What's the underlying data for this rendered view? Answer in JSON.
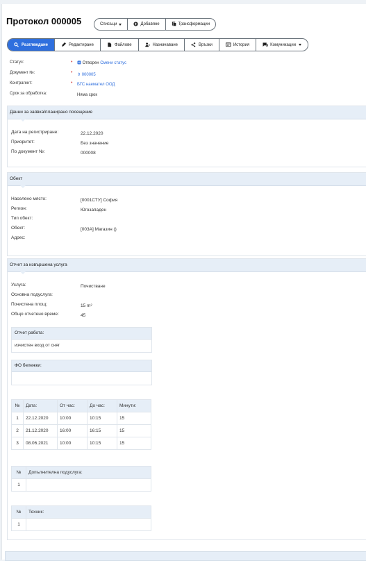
{
  "header": {
    "title": "Протокол 000005"
  },
  "toolbar": {
    "lists_label": "Списъци",
    "add_label": "Добавяне",
    "transform_label": "Трансформации"
  },
  "tabs": [
    "Разглеждане",
    "Редактиране",
    "Файлове",
    "Назначаване",
    "Връзки",
    "История",
    "Комуникации"
  ],
  "summary": {
    "status_label": "Статус:",
    "status_value": "Отворен",
    "status_action": "Смени статус",
    "document_label": "Документ №:",
    "document_value": "000005",
    "contractor_label": "Контрагент:",
    "contractor_value": "БГС наемател ООД",
    "deadline_label": "Срок за обработка:",
    "deadline_value": "Няма срок"
  },
  "request": {
    "title": "Данни за заявка/планирано посещение",
    "reg_date_label": "Дата на регистриране:",
    "reg_date_value": "22.12.2020",
    "priority_label": "Приоритет:",
    "priority_value": "Без значение",
    "doc_label": "По документ №:",
    "doc_value": "000008"
  },
  "object": {
    "title": "Обект",
    "place_label": "Населено място:",
    "place_value": "[0001СТУ] София",
    "region_label": "Регион:",
    "region_value": "Югозападен",
    "type_label": "Тип обект:",
    "object_label": "Обект:",
    "object_value": "[003A] Магазин ()",
    "address_label": "Адрес:"
  },
  "report": {
    "title": "Отчет за извършена услуга",
    "service_label": "Услуга:",
    "service_value": "Почистване",
    "subservice_label": "Основна подуслуга:",
    "area_label": "Почистена площ:",
    "area_value": "15 m²",
    "time_label": "Общо отчетено време:",
    "time_value": "45",
    "work_label": "Отчет работа:",
    "work_value": "изчистен вход от сняг",
    "fo_label": "ФО бележки:",
    "time_table": {
      "headers": [
        "№",
        "Дата:",
        "От час:",
        "До час:",
        "Минути:"
      ],
      "rows": [
        [
          "1",
          "22.12.2020",
          "10:00",
          "10:15",
          "15"
        ],
        [
          "2",
          "21.12.2020",
          "16:00",
          "16:15",
          "15"
        ],
        [
          "3",
          "08.06.2021",
          "10:00",
          "10:15",
          "15"
        ]
      ]
    },
    "extra_table": {
      "headers": [
        "№",
        "Допълнителна подуслуга:"
      ],
      "rows": [
        [
          "1",
          ""
        ]
      ]
    },
    "tech_table": {
      "headers": [
        "№",
        "Техник:"
      ],
      "rows": [
        [
          "1",
          ""
        ]
      ]
    }
  }
}
